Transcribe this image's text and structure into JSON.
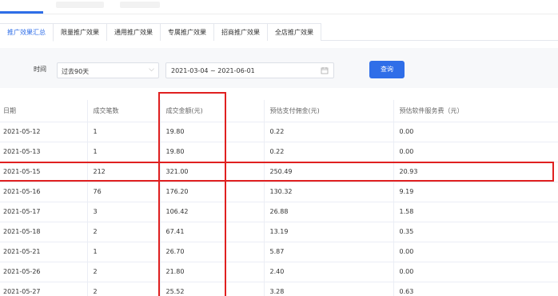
{
  "tabs": [
    {
      "label": "推广效果汇总",
      "active": true
    },
    {
      "label": "限量推广效果",
      "active": false
    },
    {
      "label": "通用推广效果",
      "active": false
    },
    {
      "label": "专属推广效果",
      "active": false
    },
    {
      "label": "招商推广效果",
      "active": false
    },
    {
      "label": "全店推广效果",
      "active": false
    }
  ],
  "filter": {
    "time_label": "时间",
    "period_value": "过去90天",
    "date_range": "2021-03-04 ~ 2021-06-01",
    "query_button": "查询"
  },
  "table": {
    "headers": [
      "日期",
      "成交笔数",
      "成交金额(元)",
      "预估支付佣金(元)",
      "预估软件服务费（元）"
    ],
    "rows": [
      [
        "2021-05-12",
        "1",
        "19.80",
        "0.22",
        "0.00"
      ],
      [
        "2021-05-13",
        "1",
        "19.80",
        "0.22",
        "0.00"
      ],
      [
        "2021-05-15",
        "212",
        "321.00",
        "250.49",
        "20.93"
      ],
      [
        "2021-05-16",
        "76",
        "176.20",
        "130.32",
        "9.19"
      ],
      [
        "2021-05-17",
        "3",
        "106.42",
        "26.88",
        "1.58"
      ],
      [
        "2021-05-18",
        "2",
        "67.41",
        "13.19",
        "0.35"
      ],
      [
        "2021-05-21",
        "1",
        "26.70",
        "5.87",
        "0.00"
      ],
      [
        "2021-05-26",
        "2",
        "21.80",
        "2.40",
        "0.00"
      ],
      [
        "2021-05-27",
        "2",
        "25.52",
        "3.28",
        "0.63"
      ]
    ]
  },
  "colors": {
    "accent": "#2f6ee8",
    "highlight": "#e02020"
  }
}
